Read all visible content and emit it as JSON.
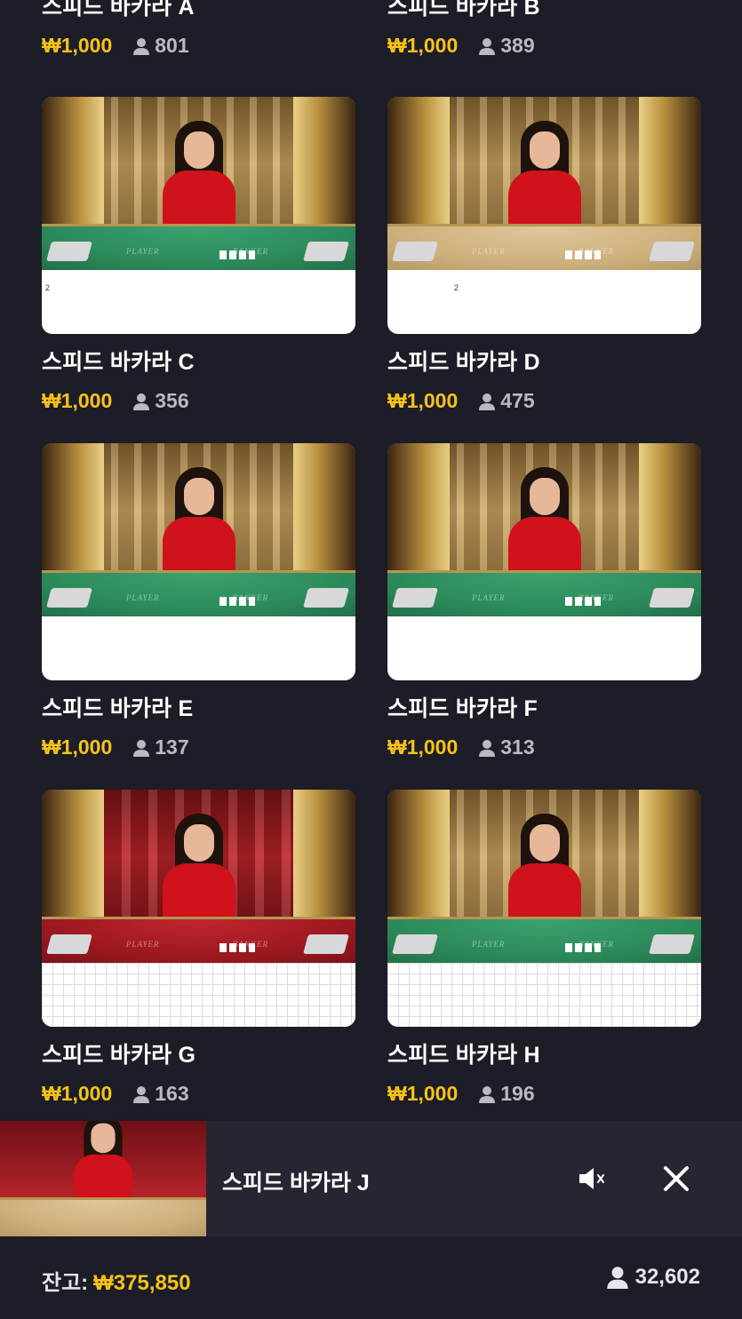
{
  "top_row": [
    {
      "title": "스피드 바카라 A",
      "price": "₩1,000",
      "players": "801"
    },
    {
      "title": "스피드 바카라 B",
      "price": "₩1,000",
      "players": "389"
    }
  ],
  "tables": [
    {
      "title": "스피드 바카라 C",
      "price": "₩1,000",
      "players": "356",
      "stream_number": "2",
      "felt": "green"
    },
    {
      "title": "스피드 바카라 D",
      "price": "₩1,000",
      "players": "475",
      "stream_number": "2",
      "felt": "beige"
    },
    {
      "title": "스피드 바카라 E",
      "price": "₩1,000",
      "players": "137",
      "stream_number": "",
      "felt": "green"
    },
    {
      "title": "스피드 바카라 F",
      "price": "₩1,000",
      "players": "313",
      "stream_number": "",
      "felt": "green"
    },
    {
      "title": "스피드 바카라 G",
      "price": "₩1,000",
      "players": "163",
      "stream_number": "",
      "felt": "red"
    },
    {
      "title": "스피드 바카라 H",
      "price": "₩1,000",
      "players": "196",
      "stream_number": "",
      "felt": "green"
    }
  ],
  "table_labels": {
    "player": "PLAYER",
    "banker": "BANKER"
  },
  "mini_player": {
    "title": "스피드 바카라 J",
    "mute_icon": "speaker-muted-icon",
    "close_icon": "close-icon"
  },
  "footer": {
    "balance_label": "잔고:",
    "balance_value": "₩375,850",
    "online_count": "32,602"
  },
  "colors": {
    "background": "#1c1d26",
    "price": "#f6c21a",
    "player_count": "#b9bac2"
  }
}
